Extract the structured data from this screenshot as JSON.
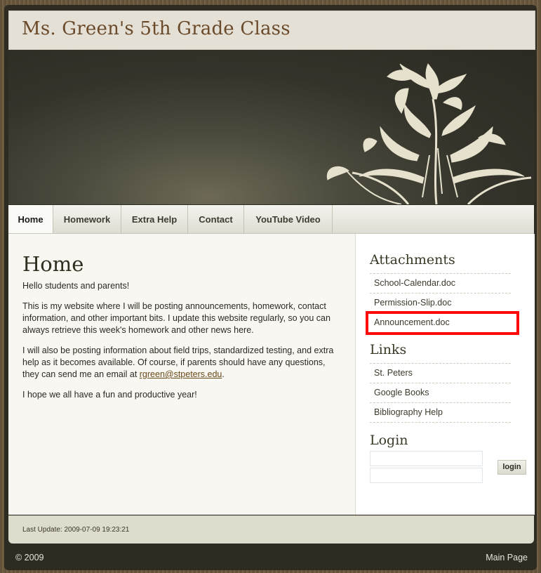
{
  "site": {
    "title": "Ms. Green's 5th Grade Class"
  },
  "nav": {
    "items": [
      {
        "label": "Home"
      },
      {
        "label": "Homework"
      },
      {
        "label": "Extra Help"
      },
      {
        "label": "Contact"
      },
      {
        "label": "YouTube Video"
      }
    ],
    "active": "Home"
  },
  "main": {
    "heading": "Home",
    "p1": "Hello students and parents!",
    "p2": "This is my website where I will be posting announcements, homework, contact information, and other important bits. I update this website regularly, so you can always retrieve this week's homework and other news here.",
    "p3_text": "I will also be posting information about field trips, standardized testing, and extra help as it becomes available. Of course, if parents should have any questions, they can send me an email at ",
    "p3_email": "rgreen@stpeters.edu",
    "p3_end": ".",
    "p4": "I hope we all have a fun and productive year!"
  },
  "sidebar": {
    "attachments_heading": "Attachments",
    "attachments": [
      {
        "label": "School-Calendar.doc"
      },
      {
        "label": "Permission-Slip.doc"
      },
      {
        "label": "Announcement.doc"
      }
    ],
    "links_heading": "Links",
    "links": [
      {
        "label": "St. Peters"
      },
      {
        "label": "Google Books"
      },
      {
        "label": "Bibliography Help"
      }
    ],
    "login_heading": "Login",
    "login_button": "login"
  },
  "footer": {
    "last_update": "Last Update: 2009-07-09 19:23:21",
    "copyright": "© 2009",
    "main_page": "Main Page"
  },
  "colors": {
    "title_text": "#6b4a2a",
    "highlight": "#ff0a0a",
    "frame": "#2e2c22"
  }
}
